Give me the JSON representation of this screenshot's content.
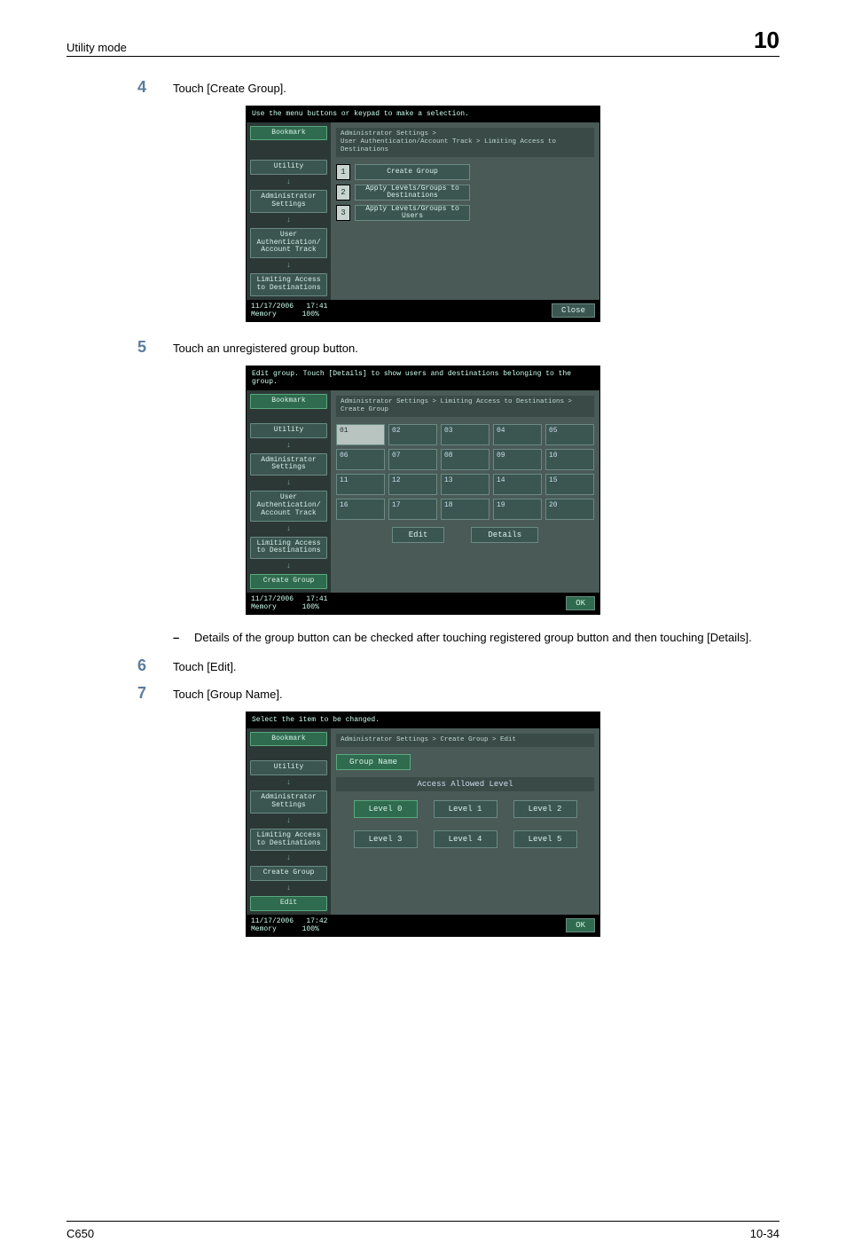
{
  "header": {
    "title": "Utility mode",
    "chapter": "10"
  },
  "steps": {
    "s4": {
      "num": "4",
      "text": "Touch [Create Group]."
    },
    "s5": {
      "num": "5",
      "text": "Touch an unregistered group button."
    },
    "sub5": "Details of the group button can be checked after touching registered group button and then touching [Details].",
    "s6": {
      "num": "6",
      "text": "Touch [Edit]."
    },
    "s7": {
      "num": "7",
      "text": "Touch [Group Name]."
    }
  },
  "scr1": {
    "top": "Use the menu buttons or keypad to make a selection.",
    "crumb1": "Administrator Settings >",
    "crumb2": "User Authentication/Account Track > Limiting Access to Destinations",
    "side": {
      "bookmark": "Bookmark",
      "utility": "Utility",
      "admin": "Administrator Settings",
      "uat": "User Authentication/ Account Track",
      "limit": "Limiting Access to Destinations"
    },
    "opts": {
      "n1": "1",
      "b1": "Create Group",
      "n2": "2",
      "b2": "Apply Levels/Groups to Destinations",
      "n3": "3",
      "b3": "Apply Levels/Groups to Users"
    },
    "footer": {
      "date": "11/17/2006",
      "time": "17:41",
      "mem": "Memory",
      "pct": "100%",
      "close": "Close"
    }
  },
  "scr2": {
    "top": "Edit group. Touch [Details] to show users and destinations belonging to the group.",
    "crumb": "Administrator Settings > Limiting Access to Destinations > Create Group",
    "side": {
      "bookmark": "Bookmark",
      "utility": "Utility",
      "admin": "Administrator Settings",
      "uat": "User Authentication/ Account Track",
      "limit": "Limiting Access to Destinations",
      "create": "Create Group"
    },
    "slots": [
      "01",
      "02",
      "03",
      "04",
      "05",
      "06",
      "07",
      "08",
      "09",
      "10",
      "11",
      "12",
      "13",
      "14",
      "15",
      "16",
      "17",
      "18",
      "19",
      "20"
    ],
    "edit": "Edit",
    "details": "Details",
    "footer": {
      "date": "11/17/2006",
      "time": "17:41",
      "mem": "Memory",
      "pct": "100%",
      "ok": "OK"
    }
  },
  "scr3": {
    "top": "Select the item to be changed.",
    "crumb": "Administrator Settings > Create Group > Edit",
    "side": {
      "bookmark": "Bookmark",
      "utility": "Utility",
      "admin": "Administrator Settings",
      "limit": "Limiting Access to Destinations",
      "create": "Create Group",
      "edit": "Edit"
    },
    "groupName": "Group Name",
    "levelHead": "Access Allowed Level",
    "levels": {
      "l0": "Level 0",
      "l1": "Level 1",
      "l2": "Level 2",
      "l3": "Level 3",
      "l4": "Level 4",
      "l5": "Level 5"
    },
    "footer": {
      "date": "11/17/2006",
      "time": "17:42",
      "mem": "Memory",
      "pct": "100%",
      "ok": "OK"
    }
  },
  "footer": {
    "model": "C650",
    "page": "10-34"
  }
}
